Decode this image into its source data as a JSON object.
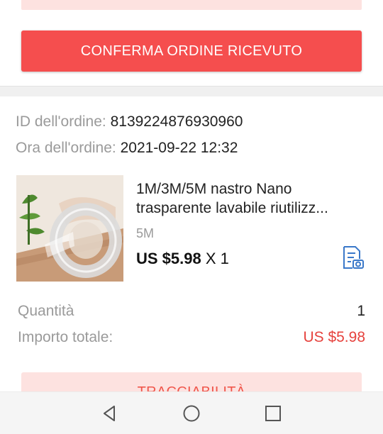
{
  "actions": {
    "confirm_label": "CONFERMA ORDINE RICEVUTO",
    "track_label": "TRACCIABILITÀ"
  },
  "order": {
    "id_label": "ID dell'ordine:",
    "id_value": "8139224876930960",
    "time_label": "Ora dell'ordine:",
    "time_value": "2021-09-22 12:32"
  },
  "product": {
    "title_line1": "1M/3M/5M nastro Nano",
    "title_line2": "trasparente lavabile riutilizz...",
    "variant": "5M",
    "price": "US $5.98",
    "quantity_suffix": "X 1",
    "snapshot_icon": "snapshot-icon"
  },
  "summary": {
    "quantity_label": "Quantità",
    "quantity_value": "1",
    "total_label": "Importo totale:",
    "total_value": "US $5.98"
  },
  "colors": {
    "accent_red": "#f54e4e",
    "total_red": "#e6423d",
    "icon_blue": "#3a78c9"
  },
  "navigation": {
    "back_icon": "back-icon",
    "home_icon": "home-icon",
    "recents_icon": "recents-icon"
  }
}
